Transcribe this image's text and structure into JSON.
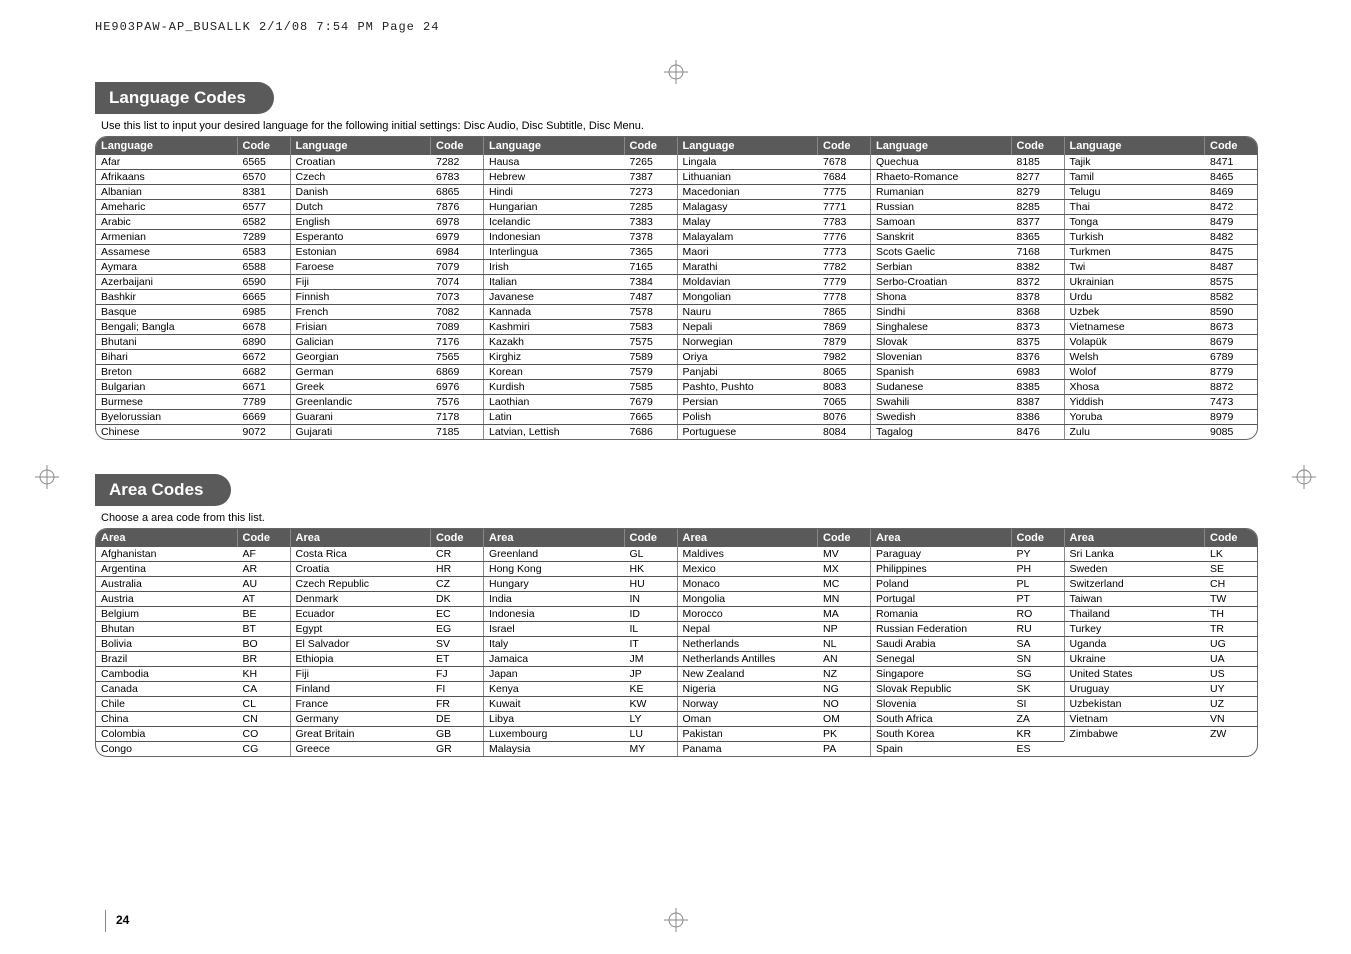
{
  "topline": "HE903PAW-AP_BUSALLK  2/1/08  7:54 PM  Page 24",
  "page_number": "24",
  "lang_section": {
    "title": "Language Codes",
    "desc": "Use this list to input your desired language for the following initial settings: Disc Audio, Disc Subtitle, Disc Menu.",
    "header1": "Language",
    "header2": "Code",
    "cols": [
      [
        [
          "Afar",
          "6565"
        ],
        [
          "Afrikaans",
          "6570"
        ],
        [
          "Albanian",
          "8381"
        ],
        [
          "Ameharic",
          "6577"
        ],
        [
          "Arabic",
          "6582"
        ],
        [
          "Armenian",
          "7289"
        ],
        [
          "Assamese",
          "6583"
        ],
        [
          "Aymara",
          "6588"
        ],
        [
          "Azerbaijani",
          "6590"
        ],
        [
          "Bashkir",
          "6665"
        ],
        [
          "Basque",
          "6985"
        ],
        [
          "Bengali; Bangla",
          "6678"
        ],
        [
          "Bhutani",
          "6890"
        ],
        [
          "Bihari",
          "6672"
        ],
        [
          "Breton",
          "6682"
        ],
        [
          "Bulgarian",
          "6671"
        ],
        [
          "Burmese",
          "7789"
        ],
        [
          "Byelorussian",
          "6669"
        ],
        [
          "Chinese",
          "9072"
        ]
      ],
      [
        [
          "Croatian",
          "7282"
        ],
        [
          "Czech",
          "6783"
        ],
        [
          "Danish",
          "6865"
        ],
        [
          "Dutch",
          "7876"
        ],
        [
          "English",
          "6978"
        ],
        [
          "Esperanto",
          "6979"
        ],
        [
          "Estonian",
          "6984"
        ],
        [
          "Faroese",
          "7079"
        ],
        [
          "Fiji",
          "7074"
        ],
        [
          "Finnish",
          "7073"
        ],
        [
          "French",
          "7082"
        ],
        [
          "Frisian",
          "7089"
        ],
        [
          "Galician",
          "7176"
        ],
        [
          "Georgian",
          "7565"
        ],
        [
          "German",
          "6869"
        ],
        [
          "Greek",
          "6976"
        ],
        [
          "Greenlandic",
          "7576"
        ],
        [
          "Guarani",
          "7178"
        ],
        [
          "Gujarati",
          "7185"
        ]
      ],
      [
        [
          "Hausa",
          "7265"
        ],
        [
          "Hebrew",
          "7387"
        ],
        [
          "Hindi",
          "7273"
        ],
        [
          "Hungarian",
          "7285"
        ],
        [
          "Icelandic",
          "7383"
        ],
        [
          "Indonesian",
          "7378"
        ],
        [
          "Interlingua",
          "7365"
        ],
        [
          "Irish",
          "7165"
        ],
        [
          "Italian",
          "7384"
        ],
        [
          "Javanese",
          "7487"
        ],
        [
          "Kannada",
          "7578"
        ],
        [
          "Kashmiri",
          "7583"
        ],
        [
          "Kazakh",
          "7575"
        ],
        [
          "Kirghiz",
          "7589"
        ],
        [
          "Korean",
          "7579"
        ],
        [
          "Kurdish",
          "7585"
        ],
        [
          "Laothian",
          "7679"
        ],
        [
          "Latin",
          "7665"
        ],
        [
          "Latvian, Lettish",
          "7686"
        ]
      ],
      [
        [
          "Lingala",
          "7678"
        ],
        [
          "Lithuanian",
          "7684"
        ],
        [
          "Macedonian",
          "7775"
        ],
        [
          "Malagasy",
          "7771"
        ],
        [
          "Malay",
          "7783"
        ],
        [
          "Malayalam",
          "7776"
        ],
        [
          "Maori",
          "7773"
        ],
        [
          "Marathi",
          "7782"
        ],
        [
          "Moldavian",
          "7779"
        ],
        [
          "Mongolian",
          "7778"
        ],
        [
          "Nauru",
          "7865"
        ],
        [
          "Nepali",
          "7869"
        ],
        [
          "Norwegian",
          "7879"
        ],
        [
          "Oriya",
          "7982"
        ],
        [
          "Panjabi",
          "8065"
        ],
        [
          "Pashto, Pushto",
          "8083"
        ],
        [
          "Persian",
          "7065"
        ],
        [
          "Polish",
          "8076"
        ],
        [
          "Portuguese",
          "8084"
        ]
      ],
      [
        [
          "Quechua",
          "8185"
        ],
        [
          "Rhaeto-Romance",
          "8277"
        ],
        [
          "Rumanian",
          "8279"
        ],
        [
          "Russian",
          "8285"
        ],
        [
          "Samoan",
          "8377"
        ],
        [
          "Sanskrit",
          "8365"
        ],
        [
          "Scots Gaelic",
          "7168"
        ],
        [
          "Serbian",
          "8382"
        ],
        [
          "Serbo-Croatian",
          "8372"
        ],
        [
          "Shona",
          "8378"
        ],
        [
          "Sindhi",
          "8368"
        ],
        [
          "Singhalese",
          "8373"
        ],
        [
          "Slovak",
          "8375"
        ],
        [
          "Slovenian",
          "8376"
        ],
        [
          "Spanish",
          "6983"
        ],
        [
          "Sudanese",
          "8385"
        ],
        [
          "Swahili",
          "8387"
        ],
        [
          "Swedish",
          "8386"
        ],
        [
          "Tagalog",
          "8476"
        ]
      ],
      [
        [
          "Tajik",
          "8471"
        ],
        [
          "Tamil",
          "8465"
        ],
        [
          "Telugu",
          "8469"
        ],
        [
          "Thai",
          "8472"
        ],
        [
          "Tonga",
          "8479"
        ],
        [
          "Turkish",
          "8482"
        ],
        [
          "Turkmen",
          "8475"
        ],
        [
          "Twi",
          "8487"
        ],
        [
          "Ukrainian",
          "8575"
        ],
        [
          "Urdu",
          "8582"
        ],
        [
          "Uzbek",
          "8590"
        ],
        [
          "Vietnamese",
          "8673"
        ],
        [
          "Volapük",
          "8679"
        ],
        [
          "Welsh",
          "6789"
        ],
        [
          "Wolof",
          "8779"
        ],
        [
          "Xhosa",
          "8872"
        ],
        [
          "Yiddish",
          "7473"
        ],
        [
          "Yoruba",
          "8979"
        ],
        [
          "Zulu",
          "9085"
        ]
      ]
    ]
  },
  "area_section": {
    "title": "Area Codes",
    "desc": "Choose a area code from this list.",
    "header1": "Area",
    "header2": "Code",
    "cols": [
      [
        [
          "Afghanistan",
          "AF"
        ],
        [
          "Argentina",
          "AR"
        ],
        [
          "Australia",
          "AU"
        ],
        [
          "Austria",
          "AT"
        ],
        [
          "Belgium",
          "BE"
        ],
        [
          "Bhutan",
          "BT"
        ],
        [
          "Bolivia",
          "BO"
        ],
        [
          "Brazil",
          "BR"
        ],
        [
          "Cambodia",
          "KH"
        ],
        [
          "Canada",
          "CA"
        ],
        [
          "Chile",
          "CL"
        ],
        [
          "China",
          "CN"
        ],
        [
          "Colombia",
          "CO"
        ],
        [
          "Congo",
          "CG"
        ]
      ],
      [
        [
          "Costa Rica",
          "CR"
        ],
        [
          "Croatia",
          "HR"
        ],
        [
          "Czech Republic",
          "CZ"
        ],
        [
          "Denmark",
          "DK"
        ],
        [
          "Ecuador",
          "EC"
        ],
        [
          "Egypt",
          "EG"
        ],
        [
          "El Salvador",
          "SV"
        ],
        [
          "Ethiopia",
          "ET"
        ],
        [
          "Fiji",
          "FJ"
        ],
        [
          "Finland",
          "FI"
        ],
        [
          "France",
          "FR"
        ],
        [
          "Germany",
          "DE"
        ],
        [
          "Great Britain",
          "GB"
        ],
        [
          "Greece",
          "GR"
        ]
      ],
      [
        [
          "Greenland",
          "GL"
        ],
        [
          "Hong Kong",
          "HK"
        ],
        [
          "Hungary",
          "HU"
        ],
        [
          "India",
          "IN"
        ],
        [
          "Indonesia",
          "ID"
        ],
        [
          "Israel",
          "IL"
        ],
        [
          "Italy",
          "IT"
        ],
        [
          "Jamaica",
          "JM"
        ],
        [
          "Japan",
          "JP"
        ],
        [
          "Kenya",
          "KE"
        ],
        [
          "Kuwait",
          "KW"
        ],
        [
          "Libya",
          "LY"
        ],
        [
          "Luxembourg",
          "LU"
        ],
        [
          "Malaysia",
          "MY"
        ]
      ],
      [
        [
          "Maldives",
          "MV"
        ],
        [
          "Mexico",
          "MX"
        ],
        [
          "Monaco",
          "MC"
        ],
        [
          "Mongolia",
          "MN"
        ],
        [
          "Morocco",
          "MA"
        ],
        [
          "Nepal",
          "NP"
        ],
        [
          "Netherlands",
          "NL"
        ],
        [
          "Netherlands Antilles",
          "AN"
        ],
        [
          "New Zealand",
          "NZ"
        ],
        [
          "Nigeria",
          "NG"
        ],
        [
          "Norway",
          "NO"
        ],
        [
          "Oman",
          "OM"
        ],
        [
          "Pakistan",
          "PK"
        ],
        [
          "Panama",
          "PA"
        ]
      ],
      [
        [
          "Paraguay",
          "PY"
        ],
        [
          "Philippines",
          "PH"
        ],
        [
          "Poland",
          "PL"
        ],
        [
          "Portugal",
          "PT"
        ],
        [
          "Romania",
          "RO"
        ],
        [
          "Russian Federation",
          "RU"
        ],
        [
          "Saudi Arabia",
          "SA"
        ],
        [
          "Senegal",
          "SN"
        ],
        [
          "Singapore",
          "SG"
        ],
        [
          "Slovak Republic",
          "SK"
        ],
        [
          "Slovenia",
          "SI"
        ],
        [
          "South Africa",
          "ZA"
        ],
        [
          "South Korea",
          "KR"
        ],
        [
          "Spain",
          "ES"
        ]
      ],
      [
        [
          "Sri Lanka",
          "LK"
        ],
        [
          "Sweden",
          "SE"
        ],
        [
          "Switzerland",
          "CH"
        ],
        [
          "Taiwan",
          "TW"
        ],
        [
          "Thailand",
          "TH"
        ],
        [
          "Turkey",
          "TR"
        ],
        [
          "Uganda",
          "UG"
        ],
        [
          "Ukraine",
          "UA"
        ],
        [
          "United States",
          "US"
        ],
        [
          "Uruguay",
          "UY"
        ],
        [
          "Uzbekistan",
          "UZ"
        ],
        [
          "Vietnam",
          "VN"
        ],
        [
          "Zimbabwe",
          "ZW"
        ]
      ]
    ]
  }
}
